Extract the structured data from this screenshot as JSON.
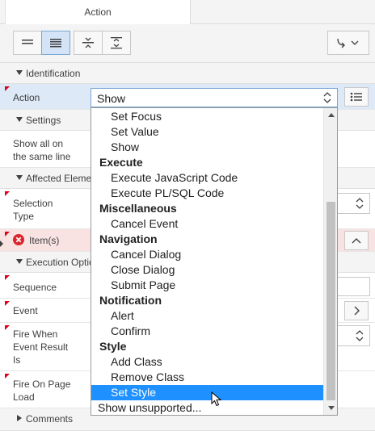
{
  "tab": {
    "label": "Action"
  },
  "toolbar": {
    "buttons": [
      "list-view-icon",
      "grid-view-icon",
      "collapse-all-icon",
      "expand-all-icon",
      "go-to-group-icon"
    ]
  },
  "sections": {
    "identification": "Identification",
    "settings": "Settings",
    "affected_elements": "Affected Eleme",
    "execution_options": "Execution Optic",
    "comments": "Comments"
  },
  "properties": {
    "action": "Action",
    "show_all_line1": "Show all on",
    "show_all_line2": "the same line",
    "selection_type_line1": "Selection",
    "selection_type_line2": "Type",
    "items": "Item(s)",
    "sequence": "Sequence",
    "event": "Event",
    "fire_when_line1": "Fire When",
    "fire_when_line2": "Event Result",
    "fire_when_line3": "Is",
    "fire_on_load_line1": "Fire On Page",
    "fire_on_load_line2": "Load"
  },
  "action_select": {
    "value": "Show"
  },
  "dropdown": {
    "items": [
      {
        "text": "Set Focus",
        "kind": "opt"
      },
      {
        "text": "Set Value",
        "kind": "opt"
      },
      {
        "text": "Show",
        "kind": "opt"
      },
      {
        "text": "Execute",
        "kind": "grp"
      },
      {
        "text": "Execute JavaScript Code",
        "kind": "opt"
      },
      {
        "text": "Execute PL/SQL Code",
        "kind": "opt"
      },
      {
        "text": "Miscellaneous",
        "kind": "grp"
      },
      {
        "text": "Cancel Event",
        "kind": "opt"
      },
      {
        "text": "Navigation",
        "kind": "grp"
      },
      {
        "text": "Cancel Dialog",
        "kind": "opt"
      },
      {
        "text": "Close Dialog",
        "kind": "opt"
      },
      {
        "text": "Submit Page",
        "kind": "opt"
      },
      {
        "text": "Notification",
        "kind": "grp"
      },
      {
        "text": "Alert",
        "kind": "opt"
      },
      {
        "text": "Confirm",
        "kind": "opt"
      },
      {
        "text": "Style",
        "kind": "grp"
      },
      {
        "text": "Add Class",
        "kind": "opt"
      },
      {
        "text": "Remove Class",
        "kind": "opt"
      },
      {
        "text": "Set Style",
        "kind": "opt",
        "highlighted": true
      },
      {
        "text": "Show unsupported...",
        "kind": "plain"
      }
    ]
  },
  "colors": {
    "highlight": "#1e90ff",
    "selected_row": "#dde9f6",
    "error_row": "#f9e2e2",
    "required_marker": "#e0001a",
    "error_icon": "#d9262c"
  }
}
